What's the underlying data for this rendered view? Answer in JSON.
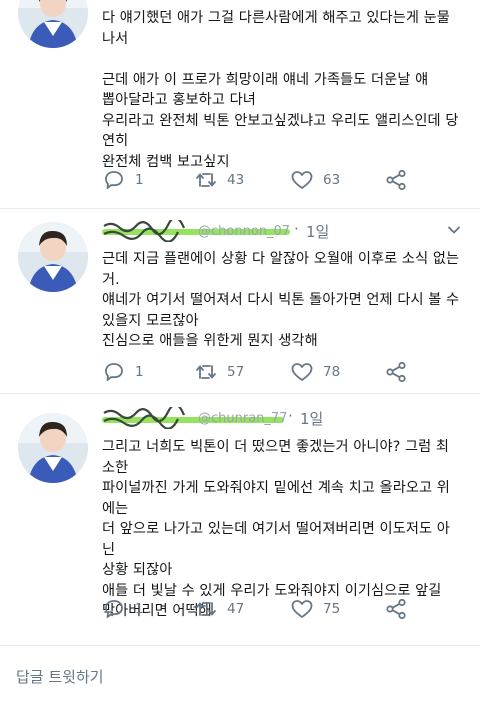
{
  "tweets": [
    {
      "text": "다 얘기했던 애가 그걸 다른사람에게 해주고 있다는게 눈물나서\n\n근데 애가 이 프로가 희망이래 얘네 가족들도 더운날 얘\n뽑아달라고 홍보하고 다녀\n우리라고 완전체 빅톤 안보고싶겠냐고 우리도 앨리스인데 당연히\n완전체 컴백 보고싶지",
      "replies": "1",
      "retweets": "43",
      "likes": "63"
    },
    {
      "handle_partial": "@chonnon_07",
      "separator": "·",
      "time": "1일",
      "text": "근데 지금 플랜에이 상황 다 알잖아 오월애 이후로 소식 없는거.\n얘네가 여기서 떨어져서 다시 빅톤 돌아가면 언제 다시 볼 수\n있을지 모르잖아\n진심으로 애들을 위한게 뭔지 생각해",
      "replies": "1",
      "retweets": "57",
      "likes": "78"
    },
    {
      "handle_partial": "@chunran_77",
      "separator": "·",
      "time": "1일",
      "text": "그리고 너희도 빅톤이 더 떴으면 좋겠는거 아니야? 그럼 최소한\n파이널까진 가게 도와줘야지 밑에선 계속 치고 올라오고 위에는\n더 앞으로 나가고 있는데 여기서 떨어져버리면 이도저도 아닌\n상황 되잖아\n애들 더 빛날 수 있게 우리가 도와줘야지 이기심으로 앞길\n막아버리면 어떡해",
      "replies": "1",
      "retweets": "47",
      "likes": "75"
    }
  ],
  "compose": {
    "placeholder": "답글 트윗하기"
  },
  "colors": {
    "text": "#14171a",
    "secondary": "#657786",
    "divider": "#e6ecf0",
    "highlight_green": "#8be04e",
    "scribble": "#3a4a3a"
  },
  "icons": {
    "reply": "reply-icon",
    "retweet": "retweet-icon",
    "like": "heart-icon",
    "share": "share-icon",
    "menu": "chevron-down-icon"
  }
}
